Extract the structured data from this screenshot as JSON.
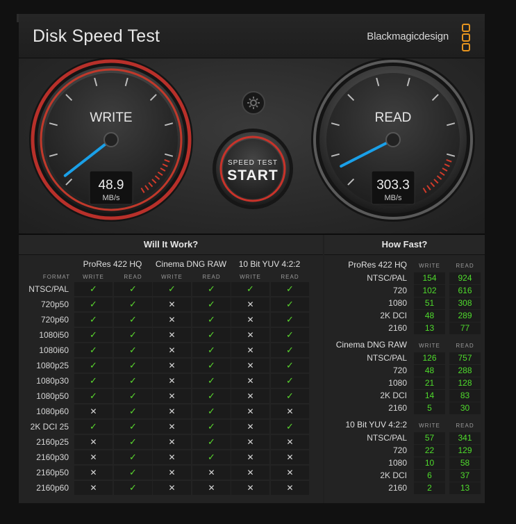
{
  "window": {
    "close_glyph": "✕",
    "title": "Disk Speed Test",
    "brand": "Blackmagicdesign"
  },
  "gauges": {
    "write": {
      "label": "WRITE",
      "value": "48.9",
      "unit": "MB/s"
    },
    "read": {
      "label": "READ",
      "value": "303.3",
      "unit": "MB/s"
    },
    "start_button": {
      "line1": "SPEED TEST",
      "line2": "START"
    },
    "settings_icon": "gear-icon",
    "needle_color": "#1aa0e8",
    "danger_color": "#d23a2a"
  },
  "will_it_work": {
    "title": "Will It Work?",
    "format_header": "FORMAT",
    "codecs": [
      "ProRes 422 HQ",
      "Cinema DNG RAW",
      "10 Bit YUV 4:2:2"
    ],
    "subheaders": [
      "WRITE",
      "READ"
    ],
    "rows": [
      {
        "format": "NTSC/PAL",
        "cells": [
          "✓",
          "✓",
          "✓",
          "✓",
          "✓",
          "✓"
        ]
      },
      {
        "format": "720p50",
        "cells": [
          "✓",
          "✓",
          "✕",
          "✓",
          "✕",
          "✓"
        ]
      },
      {
        "format": "720p60",
        "cells": [
          "✓",
          "✓",
          "✕",
          "✓",
          "✕",
          "✓"
        ]
      },
      {
        "format": "1080i50",
        "cells": [
          "✓",
          "✓",
          "✕",
          "✓",
          "✕",
          "✓"
        ]
      },
      {
        "format": "1080i60",
        "cells": [
          "✓",
          "✓",
          "✕",
          "✓",
          "✕",
          "✓"
        ]
      },
      {
        "format": "1080p25",
        "cells": [
          "✓",
          "✓",
          "✕",
          "✓",
          "✕",
          "✓"
        ]
      },
      {
        "format": "1080p30",
        "cells": [
          "✓",
          "✓",
          "✕",
          "✓",
          "✕",
          "✓"
        ]
      },
      {
        "format": "1080p50",
        "cells": [
          "✓",
          "✓",
          "✕",
          "✓",
          "✕",
          "✓"
        ]
      },
      {
        "format": "1080p60",
        "cells": [
          "✕",
          "✓",
          "✕",
          "✓",
          "✕",
          "✕"
        ]
      },
      {
        "format": "2K DCI 25",
        "cells": [
          "✓",
          "✓",
          "✕",
          "✓",
          "✕",
          "✓"
        ]
      },
      {
        "format": "2160p25",
        "cells": [
          "✕",
          "✓",
          "✕",
          "✓",
          "✕",
          "✕"
        ]
      },
      {
        "format": "2160p30",
        "cells": [
          "✕",
          "✓",
          "✕",
          "✓",
          "✕",
          "✕"
        ]
      },
      {
        "format": "2160p50",
        "cells": [
          "✕",
          "✓",
          "✕",
          "✕",
          "✕",
          "✕"
        ]
      },
      {
        "format": "2160p60",
        "cells": [
          "✕",
          "✓",
          "✕",
          "✕",
          "✕",
          "✕"
        ]
      }
    ]
  },
  "how_fast": {
    "title": "How Fast?",
    "col_write": "WRITE",
    "col_read": "READ",
    "groups": [
      {
        "codec": "ProRes 422 HQ",
        "rows": [
          {
            "format": "NTSC/PAL",
            "write": "154",
            "read": "924"
          },
          {
            "format": "720",
            "write": "102",
            "read": "616"
          },
          {
            "format": "1080",
            "write": "51",
            "read": "308"
          },
          {
            "format": "2K DCI",
            "write": "48",
            "read": "289"
          },
          {
            "format": "2160",
            "write": "13",
            "read": "77"
          }
        ]
      },
      {
        "codec": "Cinema DNG RAW",
        "rows": [
          {
            "format": "NTSC/PAL",
            "write": "126",
            "read": "757"
          },
          {
            "format": "720",
            "write": "48",
            "read": "288"
          },
          {
            "format": "1080",
            "write": "21",
            "read": "128"
          },
          {
            "format": "2K DCI",
            "write": "14",
            "read": "83"
          },
          {
            "format": "2160",
            "write": "5",
            "read": "30"
          }
        ]
      },
      {
        "codec": "10 Bit YUV 4:2:2",
        "rows": [
          {
            "format": "NTSC/PAL",
            "write": "57",
            "read": "341"
          },
          {
            "format": "720",
            "write": "22",
            "read": "129"
          },
          {
            "format": "1080",
            "write": "10",
            "read": "58"
          },
          {
            "format": "2K DCI",
            "write": "6",
            "read": "37"
          },
          {
            "format": "2160",
            "write": "2",
            "read": "13"
          }
        ]
      }
    ]
  }
}
